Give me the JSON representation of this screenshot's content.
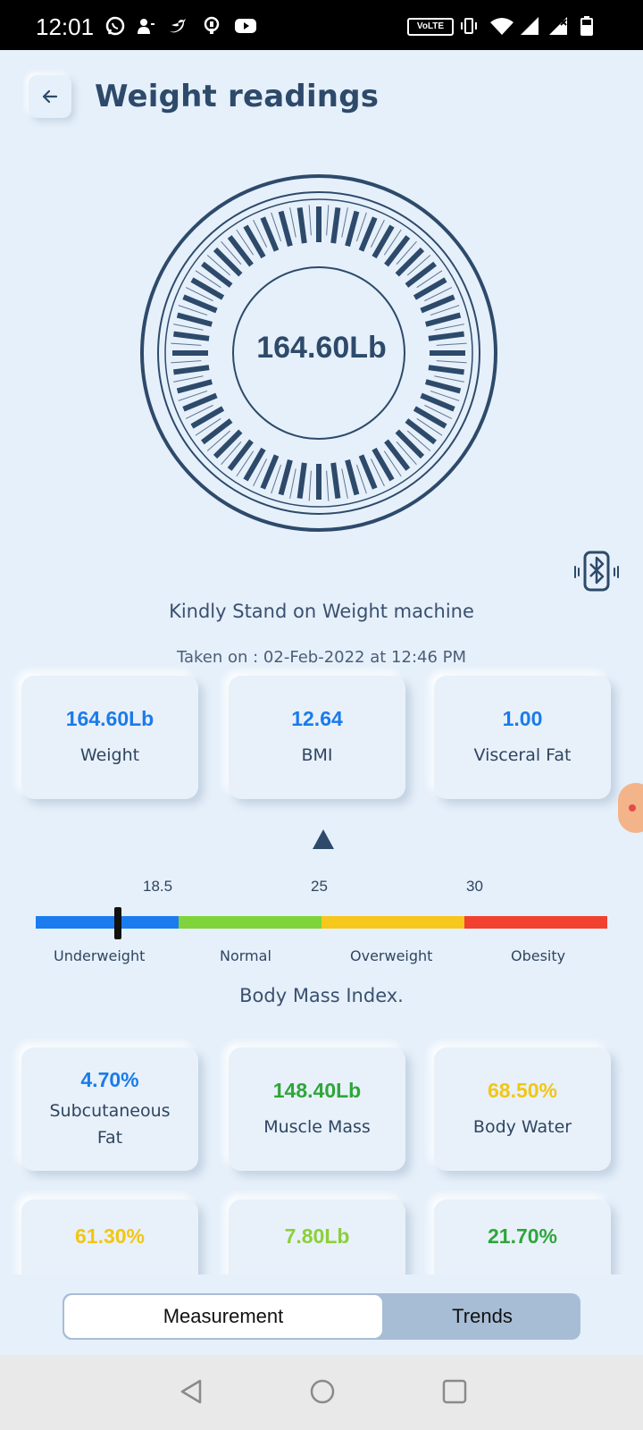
{
  "status_bar": {
    "time": "12:01",
    "network_badge": "VoLTE",
    "icons": [
      "whatsapp-icon",
      "contacts-icon",
      "twitter-icon",
      "trophy-icon",
      "youtube-icon",
      "vibrate-icon",
      "wifi-icon",
      "signal-icon",
      "signal-icon",
      "battery-icon"
    ]
  },
  "header": {
    "title": "Weight readings",
    "back_icon": "arrow-left-icon"
  },
  "scale": {
    "value": "164.60Lb"
  },
  "bluetooth_icon": "bluetooth-icon",
  "instruction": "Kindly Stand on Weight machine",
  "taken_on": "Taken on : 02-Feb-2022 at 12:46 PM",
  "metrics_row1": [
    {
      "value": "164.60Lb",
      "label": "Weight",
      "color": "#1a7bea"
    },
    {
      "value": "12.64",
      "label": "BMI",
      "color": "#1a7bea"
    },
    {
      "value": "1.00",
      "label": "Visceral Fat",
      "color": "#1a7bea"
    }
  ],
  "bmi_scale": {
    "ticks": [
      "18.5",
      "25",
      "30"
    ],
    "categories": [
      "Underweight",
      "Normal",
      "Overweight",
      "Obesity"
    ],
    "segment_colors": [
      "#1b7cf0",
      "#7ed43a",
      "#f7c81c",
      "#f2412f"
    ],
    "marker_value": 12.64,
    "caption": "Body Mass Index."
  },
  "metrics_row2": [
    {
      "value": "4.70%",
      "label_line1": "Subcutaneous",
      "label_line2": "Fat",
      "color": "#1a7bea"
    },
    {
      "value": "148.40Lb",
      "label": "Muscle Mass",
      "color": "#2ea63a"
    },
    {
      "value": "68.50%",
      "label": "Body Water",
      "color": "#f2c614"
    }
  ],
  "metrics_row3": [
    {
      "value": "61.30%",
      "color": "#f2c614"
    },
    {
      "value": "7.80Lb",
      "color": "#8ccf3a"
    },
    {
      "value": "21.70%",
      "color": "#2ea63a"
    }
  ],
  "tabs": {
    "measurement": "Measurement",
    "trends": "Trends",
    "active": "Measurement"
  },
  "nav": [
    "back-nav-icon",
    "home-nav-icon",
    "recents-nav-icon"
  ]
}
